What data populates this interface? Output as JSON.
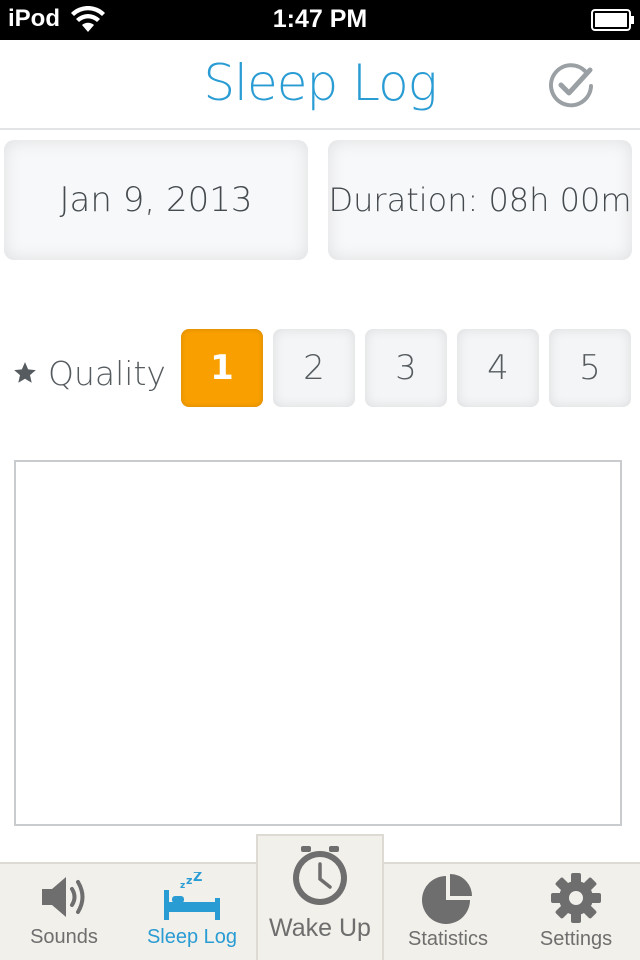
{
  "status_bar": {
    "carrier": "iPod",
    "time": "1:47 PM"
  },
  "nav": {
    "title": "Sleep Log"
  },
  "entry": {
    "date": "Jan 9, 2013",
    "duration": "Duration: 08h 00m"
  },
  "quality": {
    "label": "Quality",
    "options": [
      "1",
      "2",
      "3",
      "4",
      "5"
    ],
    "selected": "1"
  },
  "notes": {
    "value": "",
    "placeholder": ""
  },
  "tabs": {
    "sounds": "Sounds",
    "sleep_log": "Sleep Log",
    "wake_up": "Wake Up",
    "statistics": "Statistics",
    "settings": "Settings"
  },
  "colors": {
    "accent": "#2a9cd4",
    "selected": "#f9a000",
    "icon_gray": "#6e6e6e"
  }
}
